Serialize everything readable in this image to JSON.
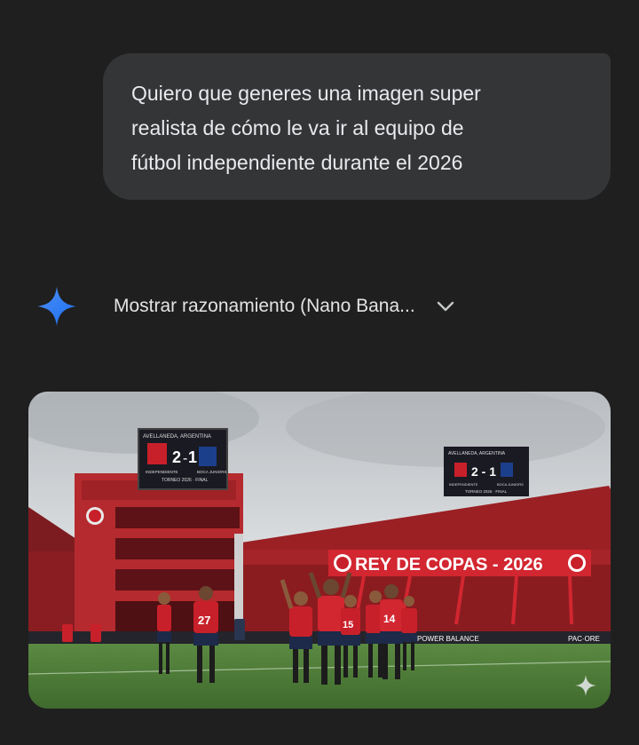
{
  "conversation": {
    "user_message": "Quiero que generes una imagen super\nrealista de cómo le va ir al equipo de\nfútbol independiente durante el 2026"
  },
  "response": {
    "assistant_icon": "gemini-spark-icon",
    "reasoning_toggle_label": "Mostrar razonamiento (Nano Bana...",
    "reasoning_toggle_icon": "chevron-down-icon"
  },
  "generated_image": {
    "description_icon": "sparkle-watermark-icon",
    "main_scoreboard": {
      "location": "AVELLANEDA, ARGENTINA",
      "home_score": "2",
      "away_score": "1",
      "home_team": "INDEPENDIENTE",
      "away_team": "BOCA JUNIORS",
      "caption": "TORNEO 2026 · FINAL"
    },
    "side_scoreboard": {
      "location": "AVELLANEDA, ARGENTINA",
      "score": "2 - 1",
      "home_team": "INDEPENDIENTE",
      "away_team": "BOCA JUNIORS",
      "caption": "TORNEO 2026 · FINAL"
    },
    "banner_text": "REY DE COPAS - 2026",
    "player_numbers": [
      "27",
      "15",
      "14"
    ],
    "ad_boards": [
      "POWER BALANCE",
      "PAC·ORE"
    ],
    "colors": {
      "sky": "#cfd3d6",
      "team_red": "#c8202a",
      "pitch": "#4e7a38",
      "stands_red": "#9a2024",
      "screen": "#1a1a22"
    }
  }
}
